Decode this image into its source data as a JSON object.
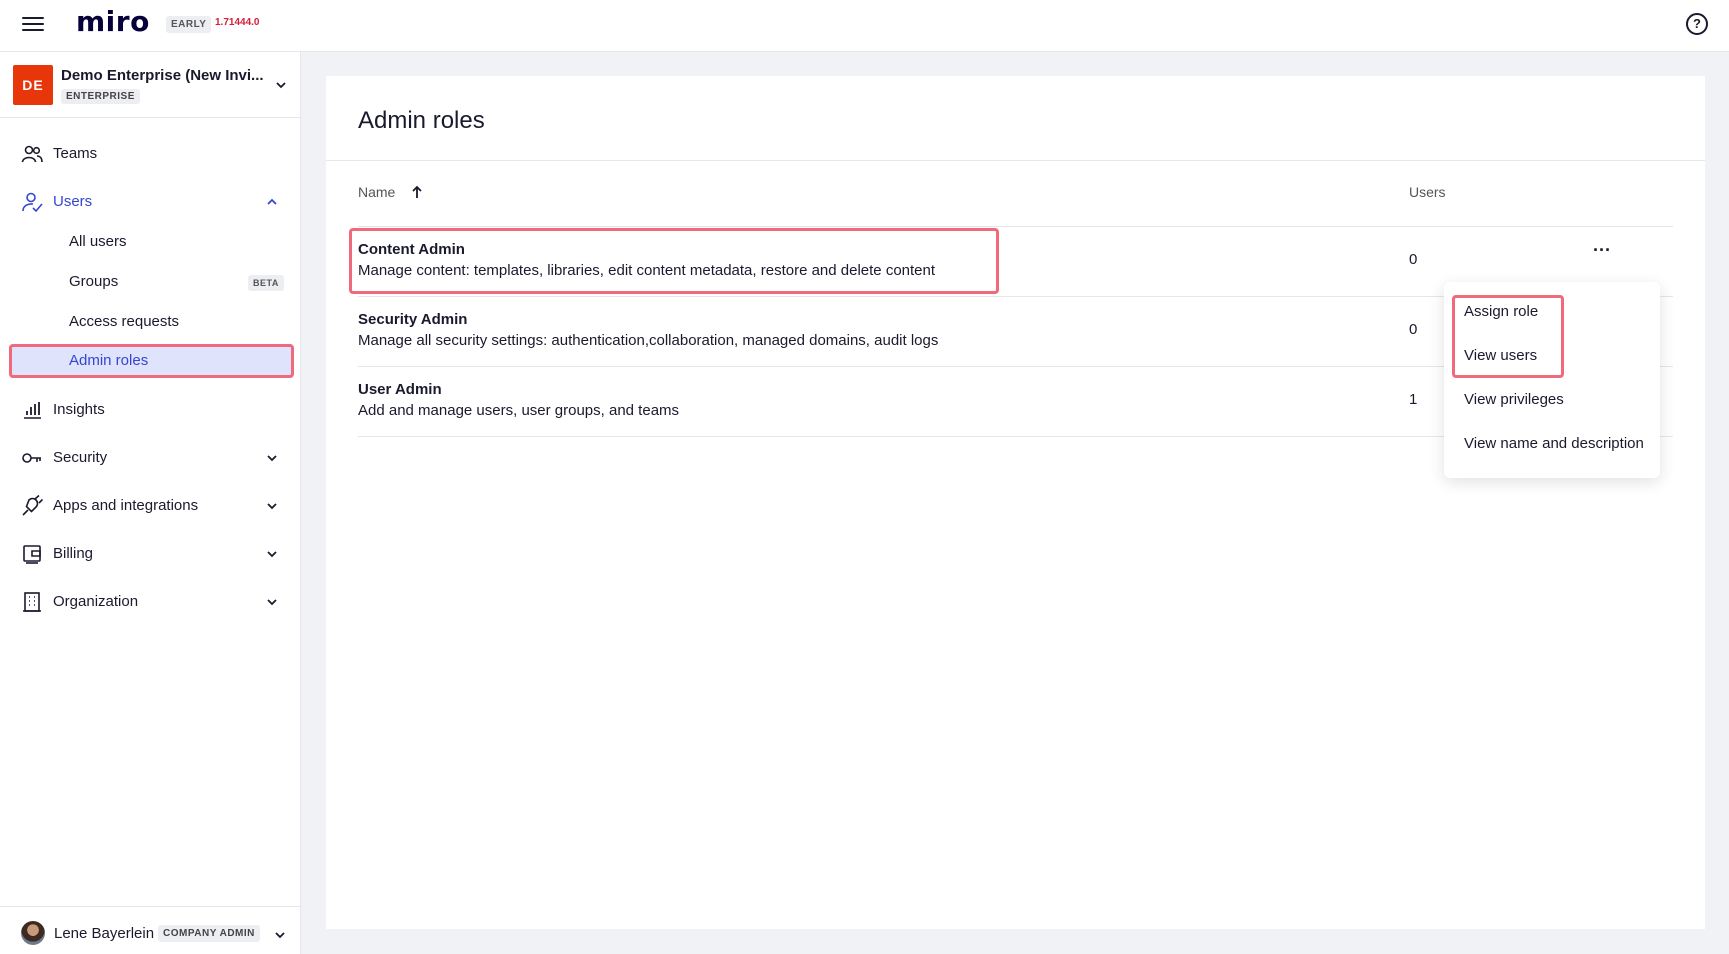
{
  "topbar": {
    "logo": "miro",
    "early_badge": "EARLY",
    "version": "1.71444.0"
  },
  "org": {
    "initials": "DE",
    "name": "Demo Enterprise (New Invi...",
    "plan": "ENTERPRISE"
  },
  "sidebar": {
    "teams": "Teams",
    "users": "Users",
    "users_sub": {
      "all_users": "All users",
      "groups": "Groups",
      "groups_badge": "BETA",
      "access_requests": "Access requests",
      "admin_roles": "Admin roles"
    },
    "insights": "Insights",
    "security": "Security",
    "apps": "Apps and integrations",
    "billing": "Billing",
    "organization": "Organization"
  },
  "user": {
    "name": "Lene Bayerlein",
    "role": "COMPANY ADMIN"
  },
  "main": {
    "title": "Admin roles",
    "columns": {
      "name": "Name",
      "users": "Users"
    },
    "rows": [
      {
        "title": "Content Admin",
        "description": "Manage content: templates, libraries, edit content metadata, restore and delete content",
        "users": "0"
      },
      {
        "title": "Security Admin",
        "description": "Manage all security settings: authentication,collaboration, managed domains, audit logs",
        "users": "0"
      },
      {
        "title": "User Admin",
        "description": "Add and manage users, user groups, and teams",
        "users": "1"
      }
    ]
  },
  "menu": {
    "assign_role": "Assign role",
    "view_users": "View users",
    "view_privileges": "View privileges",
    "view_name_description": "View name and description"
  },
  "colors": {
    "accent": "#3346d3",
    "brand_avatar": "#e8360b",
    "highlight": "#f06a7b",
    "version": "#d0203a"
  }
}
